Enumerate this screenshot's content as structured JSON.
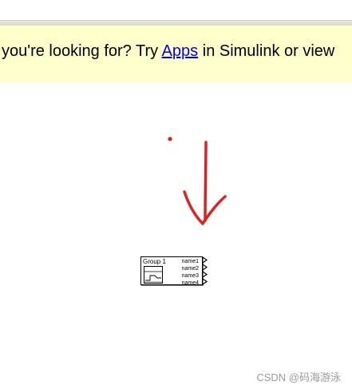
{
  "banner": {
    "text_before": "you're looking for? Try ",
    "link_label": "Apps",
    "text_after": " in Simulink or view"
  },
  "block": {
    "title": "Group 1",
    "signals": [
      "name1",
      "name2",
      "name3",
      "name4"
    ],
    "icon": "signal-builder-icon"
  },
  "annotation": {
    "color": "#dd2222",
    "icon": "down-arrow-icon"
  },
  "watermark": "CSDN @码海游泳"
}
